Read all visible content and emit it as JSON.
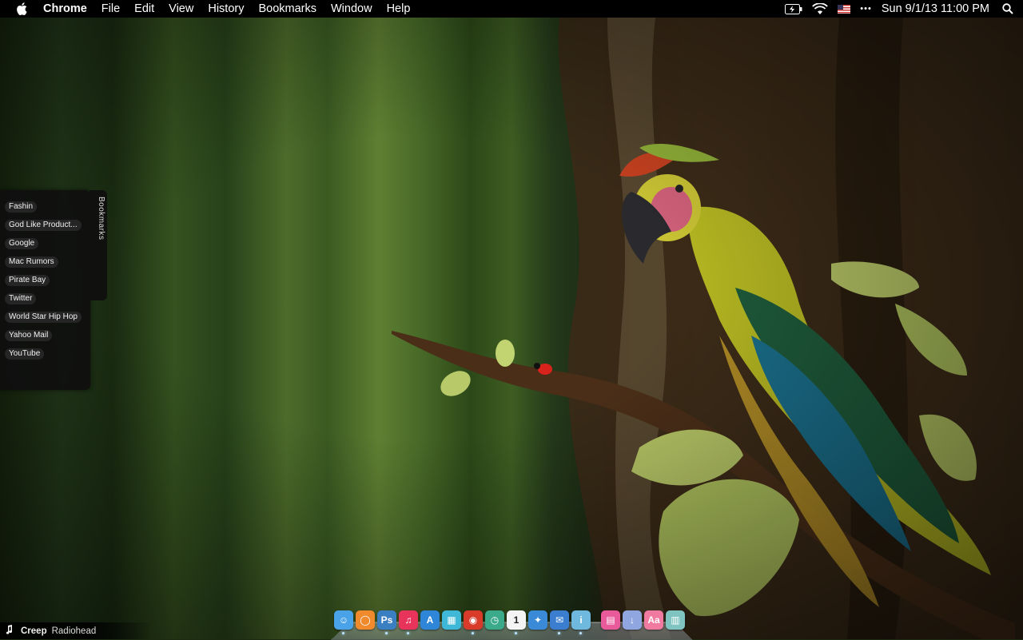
{
  "menubar": {
    "apple_icon": "apple-logo-icon",
    "app_name": "Chrome",
    "menus": [
      "File",
      "Edit",
      "View",
      "History",
      "Bookmarks",
      "Window",
      "Help"
    ],
    "status_icons": [
      "battery-charging-icon",
      "wifi-icon",
      "us-flag-input-icon",
      "more-dots-icon"
    ],
    "more_label": "•••",
    "clock": "Sun 9/1/13  11:00 PM",
    "spotlight_icon": "spotlight-search-icon"
  },
  "bookmarks": {
    "tab_label": "Bookmarks",
    "items": [
      {
        "label": "Fashin"
      },
      {
        "label": "God Like Product..."
      },
      {
        "label": "Google"
      },
      {
        "label": "Mac Rumors"
      },
      {
        "label": "Pirate Bay"
      },
      {
        "label": "Twitter"
      },
      {
        "label": "World Star Hip Hop"
      },
      {
        "label": "Yahoo Mail"
      },
      {
        "label": "YouTube"
      }
    ]
  },
  "now_playing": {
    "icon": "music-note-icon",
    "track": "Creep",
    "artist": "Radiohead"
  },
  "dock": {
    "apps": [
      {
        "name": "finder",
        "icon": "finder-icon",
        "color": "#4aa3e8",
        "glyph": "☺",
        "running": true
      },
      {
        "name": "firefox",
        "icon": "orange-circle-app-icon",
        "color": "#f08a2c",
        "glyph": "◯",
        "running": false
      },
      {
        "name": "photoshop",
        "icon": "photoshop-icon",
        "color": "#3a7fc2",
        "glyph": "Ps",
        "running": true
      },
      {
        "name": "itunes",
        "icon": "itunes-icon",
        "color": "#e8335a",
        "glyph": "♫",
        "running": true
      },
      {
        "name": "app-store",
        "icon": "app-store-icon",
        "color": "#2f86d8",
        "glyph": "A",
        "running": false
      },
      {
        "name": "final-cut",
        "icon": "clapperboard-icon",
        "color": "#3fb8d8",
        "glyph": "▦",
        "running": false
      },
      {
        "name": "chrome",
        "icon": "chrome-icon",
        "color": "#d93b2b",
        "glyph": "◉",
        "running": true
      },
      {
        "name": "time-machine",
        "icon": "time-machine-icon",
        "color": "#3aaa8a",
        "glyph": "◷",
        "running": false
      },
      {
        "name": "calendar",
        "icon": "calendar-icon",
        "color": "#f4f4f4",
        "glyph": "1",
        "running": true
      },
      {
        "name": "safari",
        "icon": "safari-icon",
        "color": "#3a8ad8",
        "glyph": "✦",
        "running": false
      },
      {
        "name": "mail",
        "icon": "mail-icon",
        "color": "#3b7ed0",
        "glyph": "✉",
        "running": true
      },
      {
        "name": "info-app",
        "icon": "info-circle-icon",
        "color": "#6fb8de",
        "glyph": "i",
        "running": true
      },
      {
        "name": "documents-stack",
        "icon": "documents-stack-icon",
        "color": "#e85a9a",
        "glyph": "▤",
        "running": false,
        "separator": true
      },
      {
        "name": "downloads-stack",
        "icon": "downloads-stack-icon",
        "color": "#8fa6e0",
        "glyph": "↓",
        "running": false
      },
      {
        "name": "dictionary",
        "icon": "dictionary-icon",
        "color": "#f07aa0",
        "glyph": "Aa",
        "running": false
      },
      {
        "name": "trash",
        "icon": "trash-icon",
        "color": "#7fc4c0",
        "glyph": "▥",
        "running": false
      }
    ]
  },
  "colors": {
    "menubar_bg": "#000000",
    "panel_bg": "#0f0f0f"
  }
}
